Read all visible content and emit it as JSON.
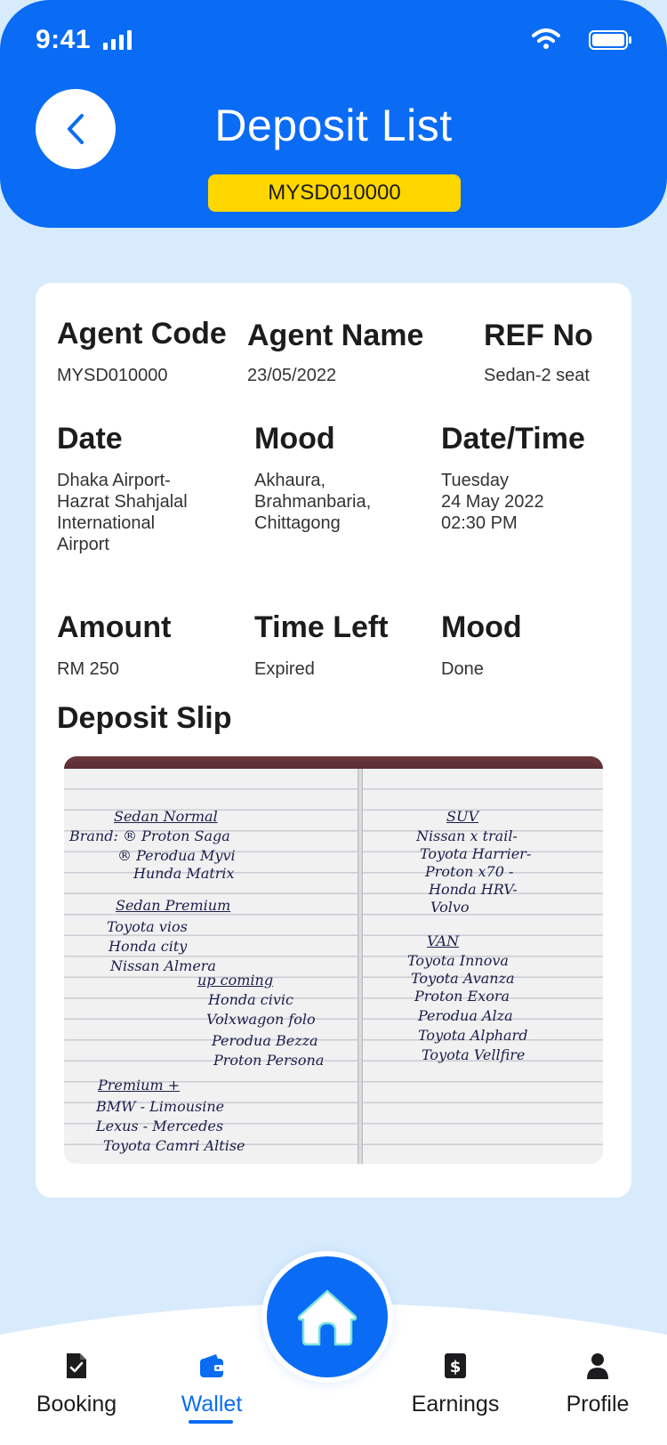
{
  "status_bar": {
    "time": "9:41"
  },
  "header": {
    "title": "Deposit List",
    "badge": "MYSD010000"
  },
  "details": [
    {
      "label": "Agent Code",
      "value": "MYSD010000"
    },
    {
      "label": "Agent Name",
      "value": "23/05/2022"
    },
    {
      "label": "REF No",
      "value": "Sedan-2 seat"
    },
    {
      "label": "Date",
      "value": "Dhaka Airport-\nHazrat Shahjalal\nInternational\nAirport"
    },
    {
      "label": "Mood",
      "value": "Akhaura,\nBrahmanbaria,\nChittagong"
    },
    {
      "label": "Date/Time",
      "value": "Tuesday\n24 May 2022\n02:30 PM"
    },
    {
      "label": "Amount",
      "value": "RM 250"
    },
    {
      "label": "Time Left",
      "value": "Expired"
    },
    {
      "label": "Mood",
      "value": "Done"
    }
  ],
  "deposit_slip": {
    "title": "Deposit Slip",
    "left_page": [
      "Sedan Normal",
      "Brand: ® Proton Saga",
      "® Perodua Myvi",
      "Hunda Matrix",
      "Sedan Premium",
      "Toyota vios",
      "Honda city",
      "Nissan Almera",
      "up coming",
      "Honda civic",
      "Volxwagon folo",
      "Perodua Bezza",
      "Proton Persona",
      "Premium +",
      "BMW - Limousine",
      "Lexus - Mercedes",
      "Toyota Camri Altise"
    ],
    "right_page": [
      "SUV",
      "Nissan x trail-",
      "Toyota Harrier-",
      "Proton x70 -",
      "Honda HRV-",
      "Volvo",
      "VAN",
      "Toyota Innova",
      "Toyota Avanza",
      "Proton Exora",
      "Perodua Alza",
      "Toyota Alphard",
      "Toyota Vellfire"
    ]
  },
  "nav": {
    "items": [
      {
        "label": "Booking",
        "icon": "document-check-icon"
      },
      {
        "label": "Wallet",
        "icon": "wallet-icon",
        "active": true
      },
      {
        "label": "Earnings",
        "icon": "dollar-icon"
      },
      {
        "label": "Profile",
        "icon": "user-icon"
      }
    ],
    "home_icon": "home-icon"
  },
  "colors": {
    "primary": "#0a6cf5",
    "badge": "#ffd700",
    "background": "#d8ebfd"
  }
}
